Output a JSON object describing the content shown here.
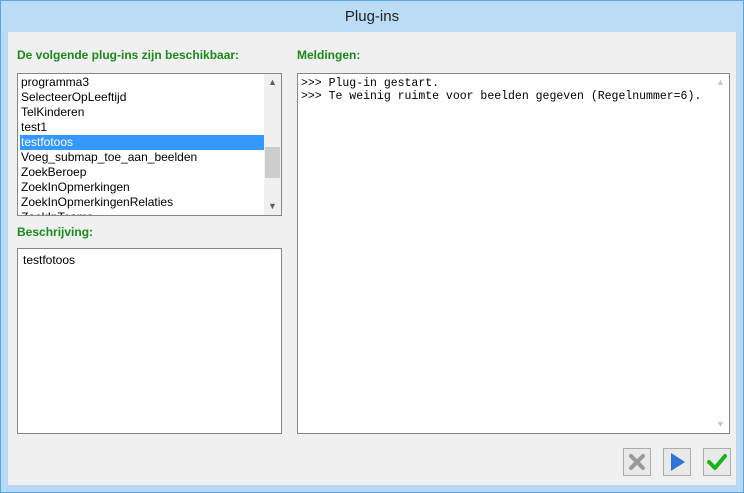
{
  "window": {
    "title": "Plug-ins"
  },
  "plugins": {
    "label": "De volgende plug-ins zijn beschikbaar:",
    "items": [
      "programma3",
      "SelecteerOpLeeftijd",
      "TelKinderen",
      "test1",
      "testfotoos",
      "Voeg_submap_toe_aan_beelden",
      "ZoekBeroep",
      "ZoekInOpmerkingen",
      "ZoekInOpmerkingenRelaties",
      "ZoekInTeams…"
    ],
    "selected_index": 4
  },
  "description": {
    "label": "Beschrijving:",
    "text": "testfotoos"
  },
  "messages": {
    "label": "Meldingen:",
    "lines": [
      ">>> Plug-in gestart.",
      ">>> Te weinig ruimte voor beelden gegeven (Regelnummer=6)."
    ]
  },
  "buttons": {
    "cancel_icon": "close-icon",
    "run_icon": "play-icon",
    "ok_icon": "checkmark-icon"
  },
  "colors": {
    "label_green": "#1a8a1a",
    "selection": "#3399ff",
    "title_bar": "#bcdcf5"
  }
}
